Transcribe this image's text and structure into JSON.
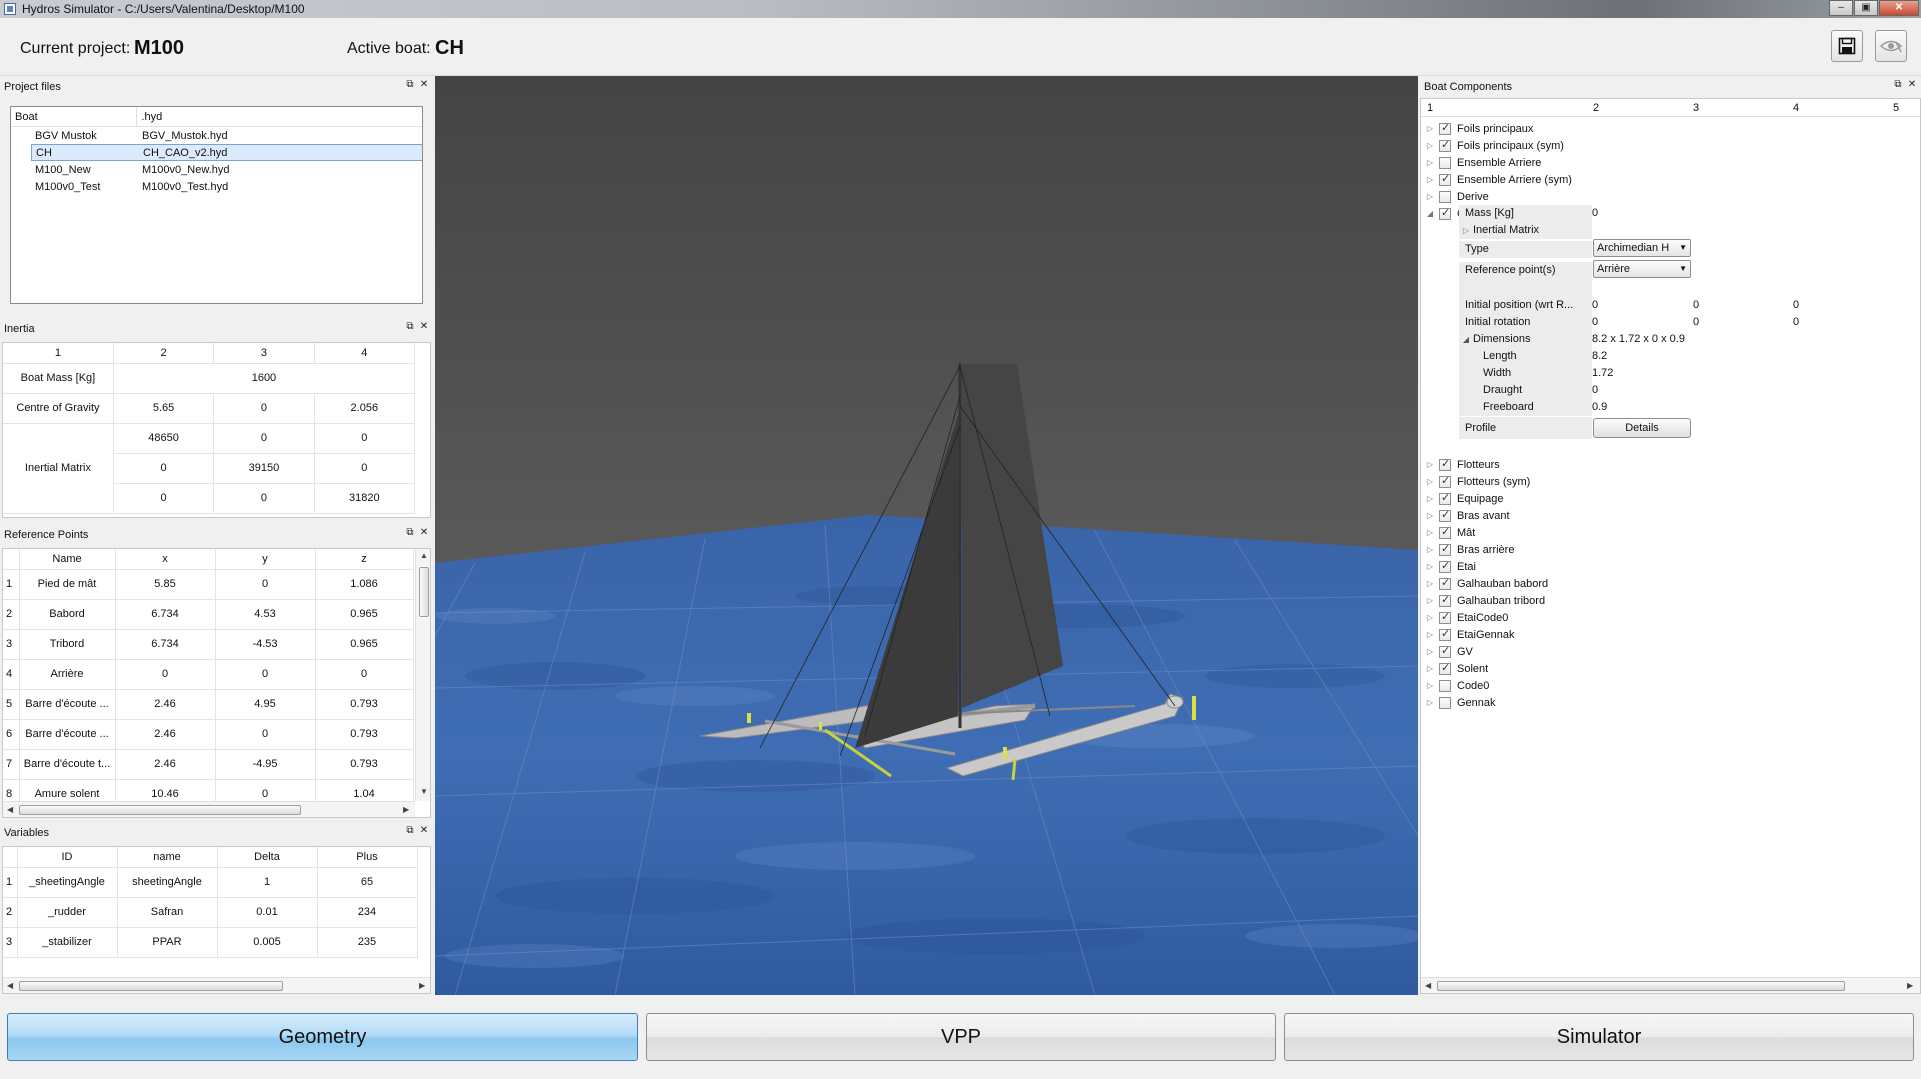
{
  "window": {
    "title": "Hydros Simulator - C:/Users/Valentina/Desktop/M100"
  },
  "header": {
    "project_label": "Current project:",
    "project_value": "M100",
    "boat_label": "Active boat:",
    "boat_value": "CH",
    "save_icon": "save-icon",
    "visibility_icon": "eye-icon"
  },
  "project_files": {
    "title": "Project files",
    "columns": [
      "Boat",
      ".hyd"
    ],
    "rows": [
      {
        "boat": "BGV Mustok",
        "file": "BGV_Mustok.hyd"
      },
      {
        "boat": "CH",
        "file": "CH_CAO_v2.hyd",
        "selected": true
      },
      {
        "boat": "M100_New",
        "file": "M100v0_New.hyd"
      },
      {
        "boat": "M100v0_Test",
        "file": "M100v0_Test.hyd"
      }
    ]
  },
  "inertia": {
    "title": "Inertia",
    "columns": [
      "1",
      "2",
      "3",
      "4"
    ],
    "mass_label": "Boat Mass [Kg]",
    "mass_value": "1600",
    "cog_label": "Centre of Gravity",
    "cog": [
      "5.65",
      "0",
      "2.056"
    ],
    "matrix_label": "Inertial Matrix",
    "matrix": [
      [
        "48650",
        "0",
        "0"
      ],
      [
        "0",
        "39150",
        "0"
      ],
      [
        "0",
        "0",
        "31820"
      ]
    ]
  },
  "reference_points": {
    "title": "Reference Points",
    "columns": [
      "Name",
      "x",
      "y",
      "z"
    ],
    "rows": [
      {
        "n": "1",
        "name": "Pied de mât",
        "x": "5.85",
        "y": "0",
        "z": "1.086"
      },
      {
        "n": "2",
        "name": "Babord",
        "x": "6.734",
        "y": "4.53",
        "z": "0.965"
      },
      {
        "n": "3",
        "name": "Tribord",
        "x": "6.734",
        "y": "-4.53",
        "z": "0.965"
      },
      {
        "n": "4",
        "name": "Arrière",
        "x": "0",
        "y": "0",
        "z": "0"
      },
      {
        "n": "5",
        "name": "Barre d'écoute ...",
        "x": "2.46",
        "y": "4.95",
        "z": "0.793"
      },
      {
        "n": "6",
        "name": "Barre d'écoute ...",
        "x": "2.46",
        "y": "0",
        "z": "0.793"
      },
      {
        "n": "7",
        "name": "Barre d'écoute t...",
        "x": "2.46",
        "y": "-4.95",
        "z": "0.793"
      },
      {
        "n": "8",
        "name": "Amure solent",
        "x": "10.46",
        "y": "0",
        "z": "1.04"
      }
    ]
  },
  "variables": {
    "title": "Variables",
    "columns": [
      "ID",
      "name",
      "Delta",
      "Plus"
    ],
    "rows": [
      {
        "n": "1",
        "id": "_sheetingAngle",
        "name": "sheetingAngle",
        "delta": "1",
        "plus": "65"
      },
      {
        "n": "2",
        "id": "_rudder",
        "name": "Safran",
        "delta": "0.01",
        "plus": "234"
      },
      {
        "n": "3",
        "id": "_stabilizer",
        "name": "PPAR",
        "delta": "0.005",
        "plus": "235"
      }
    ]
  },
  "boat_components": {
    "title": "Boat Components",
    "columns": [
      "1",
      "2",
      "3",
      "4",
      "5"
    ],
    "top_items": [
      {
        "label": "Foils principaux",
        "checked": true
      },
      {
        "label": "Foils principaux (sym)",
        "checked": true
      },
      {
        "label": "Ensemble Arriere",
        "checked": false
      },
      {
        "label": "Ensemble Arriere (sym)",
        "checked": true
      },
      {
        "label": "Derive",
        "checked": false
      },
      {
        "label": "Coque centrale",
        "checked": true,
        "expanded": true
      }
    ],
    "coque": {
      "mass_label": "Mass [Kg]",
      "mass_value": "0",
      "inertial_label": "Inertial Matrix",
      "type_label": "Type",
      "type_value": "Archimedian H",
      "ref_label": "Reference point(s)",
      "ref_value": "Arrière",
      "initpos_label": "Initial position (wrt R...",
      "initpos": [
        "0",
        "0",
        "0"
      ],
      "initrot_label": "Initial rotation",
      "initrot": [
        "0",
        "0",
        "0"
      ],
      "dims_label": "Dimensions",
      "dims_value": "8.2 x 1.72 x 0 x 0.9",
      "length_label": "Length",
      "length_value": "8.2",
      "width_label": "Width",
      "width_value": "1.72",
      "draught_label": "Draught",
      "draught_value": "0",
      "freeboard_label": "Freeboard",
      "freeboard_value": "0.9",
      "profile_label": "Profile",
      "details_label": "Details"
    },
    "bottom_items": [
      {
        "label": "Flotteurs",
        "checked": true
      },
      {
        "label": "Flotteurs (sym)",
        "checked": true
      },
      {
        "label": "Equipage",
        "checked": true
      },
      {
        "label": "Bras avant",
        "checked": true
      },
      {
        "label": "Mât",
        "checked": true
      },
      {
        "label": "Bras arrière",
        "checked": true
      },
      {
        "label": "Etai",
        "checked": true
      },
      {
        "label": "Galhauban babord",
        "checked": true
      },
      {
        "label": "Galhauban tribord",
        "checked": true
      },
      {
        "label": "EtaiCode0",
        "checked": true
      },
      {
        "label": "EtaiGennak",
        "checked": true
      },
      {
        "label": "GV",
        "checked": true
      },
      {
        "label": "Solent",
        "checked": true
      },
      {
        "label": "Code0",
        "checked": false
      },
      {
        "label": "Gennak",
        "checked": false
      }
    ]
  },
  "tabs": {
    "geometry": "Geometry",
    "vpp": "VPP",
    "simulator": "Simulator"
  }
}
